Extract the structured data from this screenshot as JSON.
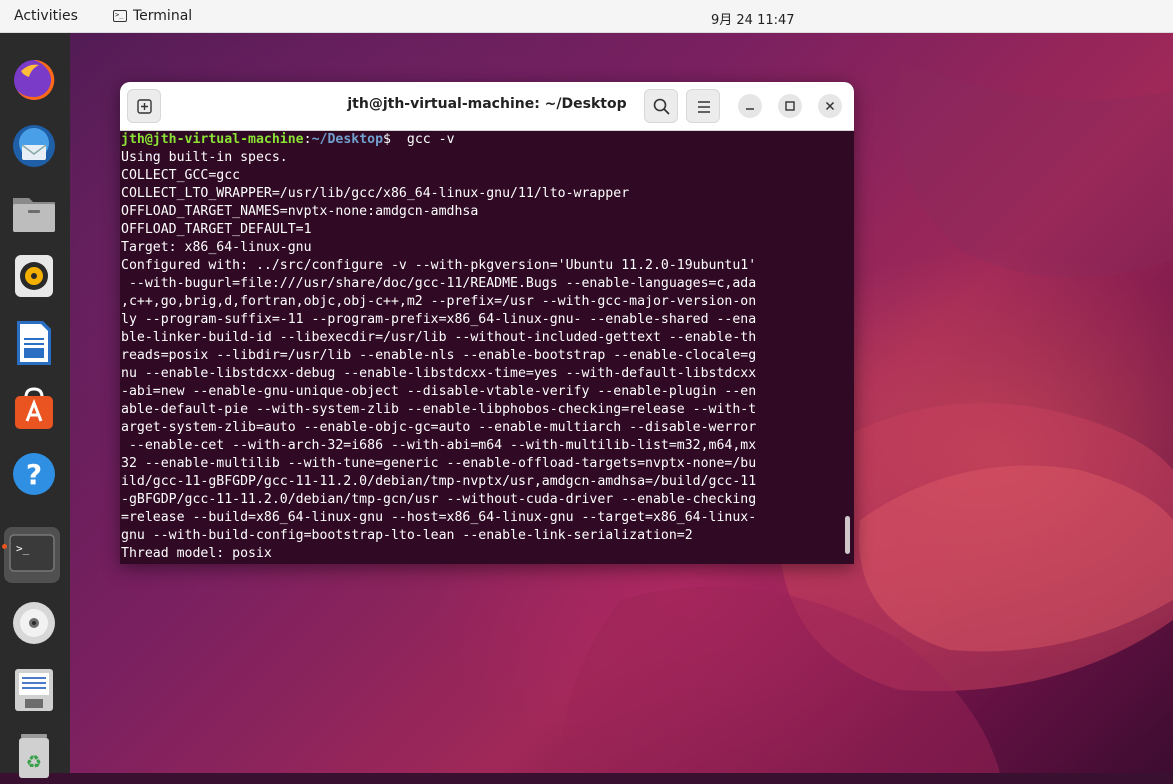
{
  "topbar": {
    "activities": "Activities",
    "app_name": "Terminal",
    "clock": "9月 24  11:47"
  },
  "dock": {
    "items": [
      "firefox-icon",
      "thunderbird-icon",
      "files-icon",
      "rhythmbox-icon",
      "writer-icon",
      "software-icon",
      "help-icon",
      "terminal-icon",
      "dvd-icon",
      "document-viewer-icon",
      "trash-icon"
    ]
  },
  "terminal": {
    "title": "jth@jth-virtual-machine: ~/Desktop",
    "prompt_user": "jth@jth-virtual-machine",
    "prompt_sep": ":",
    "prompt_path": "~/Desktop",
    "prompt_end": "$ ",
    "command": " gcc -v",
    "output_lines": [
      "Using built-in specs.",
      "COLLECT_GCC=gcc",
      "COLLECT_LTO_WRAPPER=/usr/lib/gcc/x86_64-linux-gnu/11/lto-wrapper",
      "OFFLOAD_TARGET_NAMES=nvptx-none:amdgcn-amdhsa",
      "OFFLOAD_TARGET_DEFAULT=1",
      "Target: x86_64-linux-gnu",
      "Configured with: ../src/configure -v --with-pkgversion='Ubuntu 11.2.0-19ubuntu1'",
      " --with-bugurl=file:///usr/share/doc/gcc-11/README.Bugs --enable-languages=c,ada",
      ",c++,go,brig,d,fortran,objc,obj-c++,m2 --prefix=/usr --with-gcc-major-version-on",
      "ly --program-suffix=-11 --program-prefix=x86_64-linux-gnu- --enable-shared --ena",
      "ble-linker-build-id --libexecdir=/usr/lib --without-included-gettext --enable-th",
      "reads=posix --libdir=/usr/lib --enable-nls --enable-bootstrap --enable-clocale=g",
      "nu --enable-libstdcxx-debug --enable-libstdcxx-time=yes --with-default-libstdcxx",
      "-abi=new --enable-gnu-unique-object --disable-vtable-verify --enable-plugin --en",
      "able-default-pie --with-system-zlib --enable-libphobos-checking=release --with-t",
      "arget-system-zlib=auto --enable-objc-gc=auto --enable-multiarch --disable-werror",
      " --enable-cet --with-arch-32=i686 --with-abi=m64 --with-multilib-list=m32,m64,mx",
      "32 --enable-multilib --with-tune=generic --enable-offload-targets=nvptx-none=/bu",
      "ild/gcc-11-gBFGDP/gcc-11-11.2.0/debian/tmp-nvptx/usr,amdgcn-amdhsa=/build/gcc-11",
      "-gBFGDP/gcc-11-11.2.0/debian/tmp-gcn/usr --without-cuda-driver --enable-checking",
      "=release --build=x86_64-linux-gnu --host=x86_64-linux-gnu --target=x86_64-linux-",
      "gnu --with-build-config=bootstrap-lto-lean --enable-link-serialization=2",
      "Thread model: posix"
    ]
  }
}
